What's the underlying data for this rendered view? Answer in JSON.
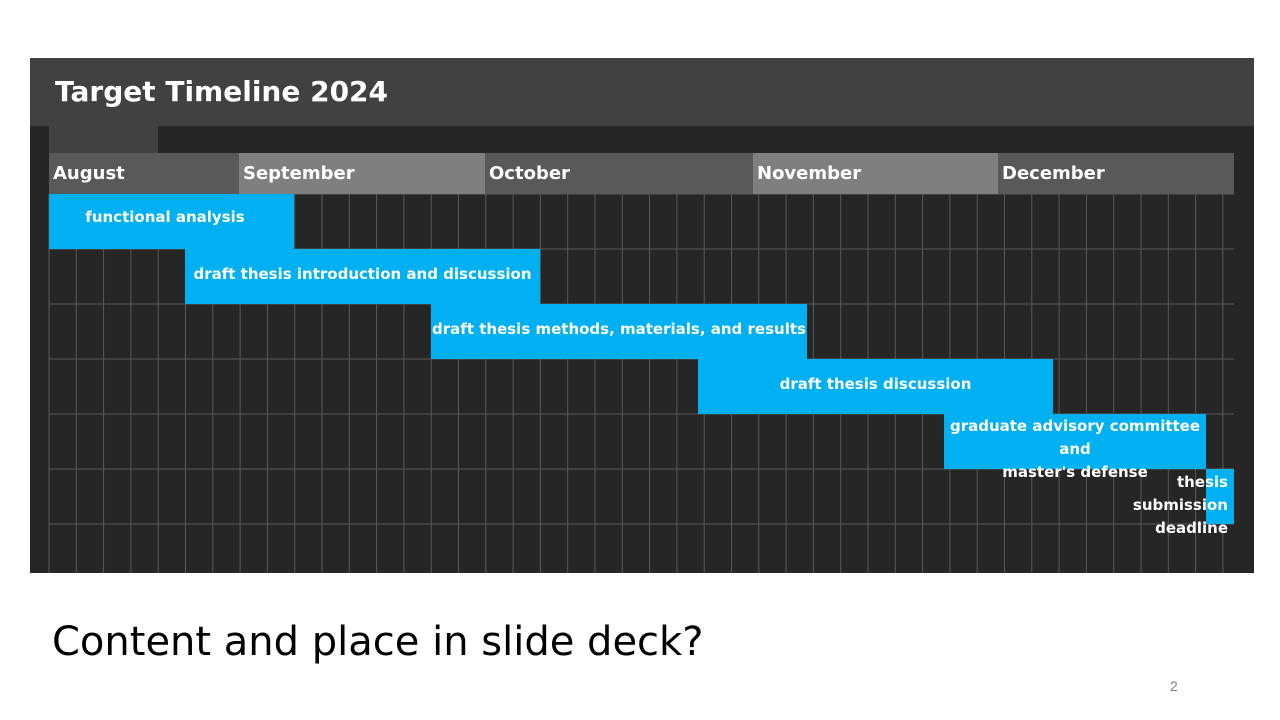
{
  "slide": {
    "panel_title": "Target Timeline 2024",
    "footer_title": "Content and place in slide deck?",
    "page_number": "2"
  },
  "months": [
    {
      "label": "August",
      "color": "#595959"
    },
    {
      "label": "September",
      "color": "#7f7f7f"
    },
    {
      "label": "October",
      "color": "#595959"
    },
    {
      "label": "November",
      "color": "#7f7f7f"
    },
    {
      "label": "December",
      "color": "#595959"
    }
  ],
  "tasks": [
    {
      "label": "functional analysis",
      "row": 0
    },
    {
      "label": "draft thesis introduction and discussion",
      "row": 1
    },
    {
      "label": "draft thesis methods, materials, and results",
      "row": 2
    },
    {
      "label": "draft thesis discussion",
      "row": 3
    },
    {
      "label": "graduate advisory committee and\nmaster's defense",
      "row": 4
    },
    {
      "label": "thesis\nsubmission\ndeadline",
      "row": 5
    }
  ],
  "colors": {
    "bar": "#00b0f0",
    "panel_bg": "#262626",
    "header_bg": "#414141",
    "grid_line": "#595959"
  }
}
